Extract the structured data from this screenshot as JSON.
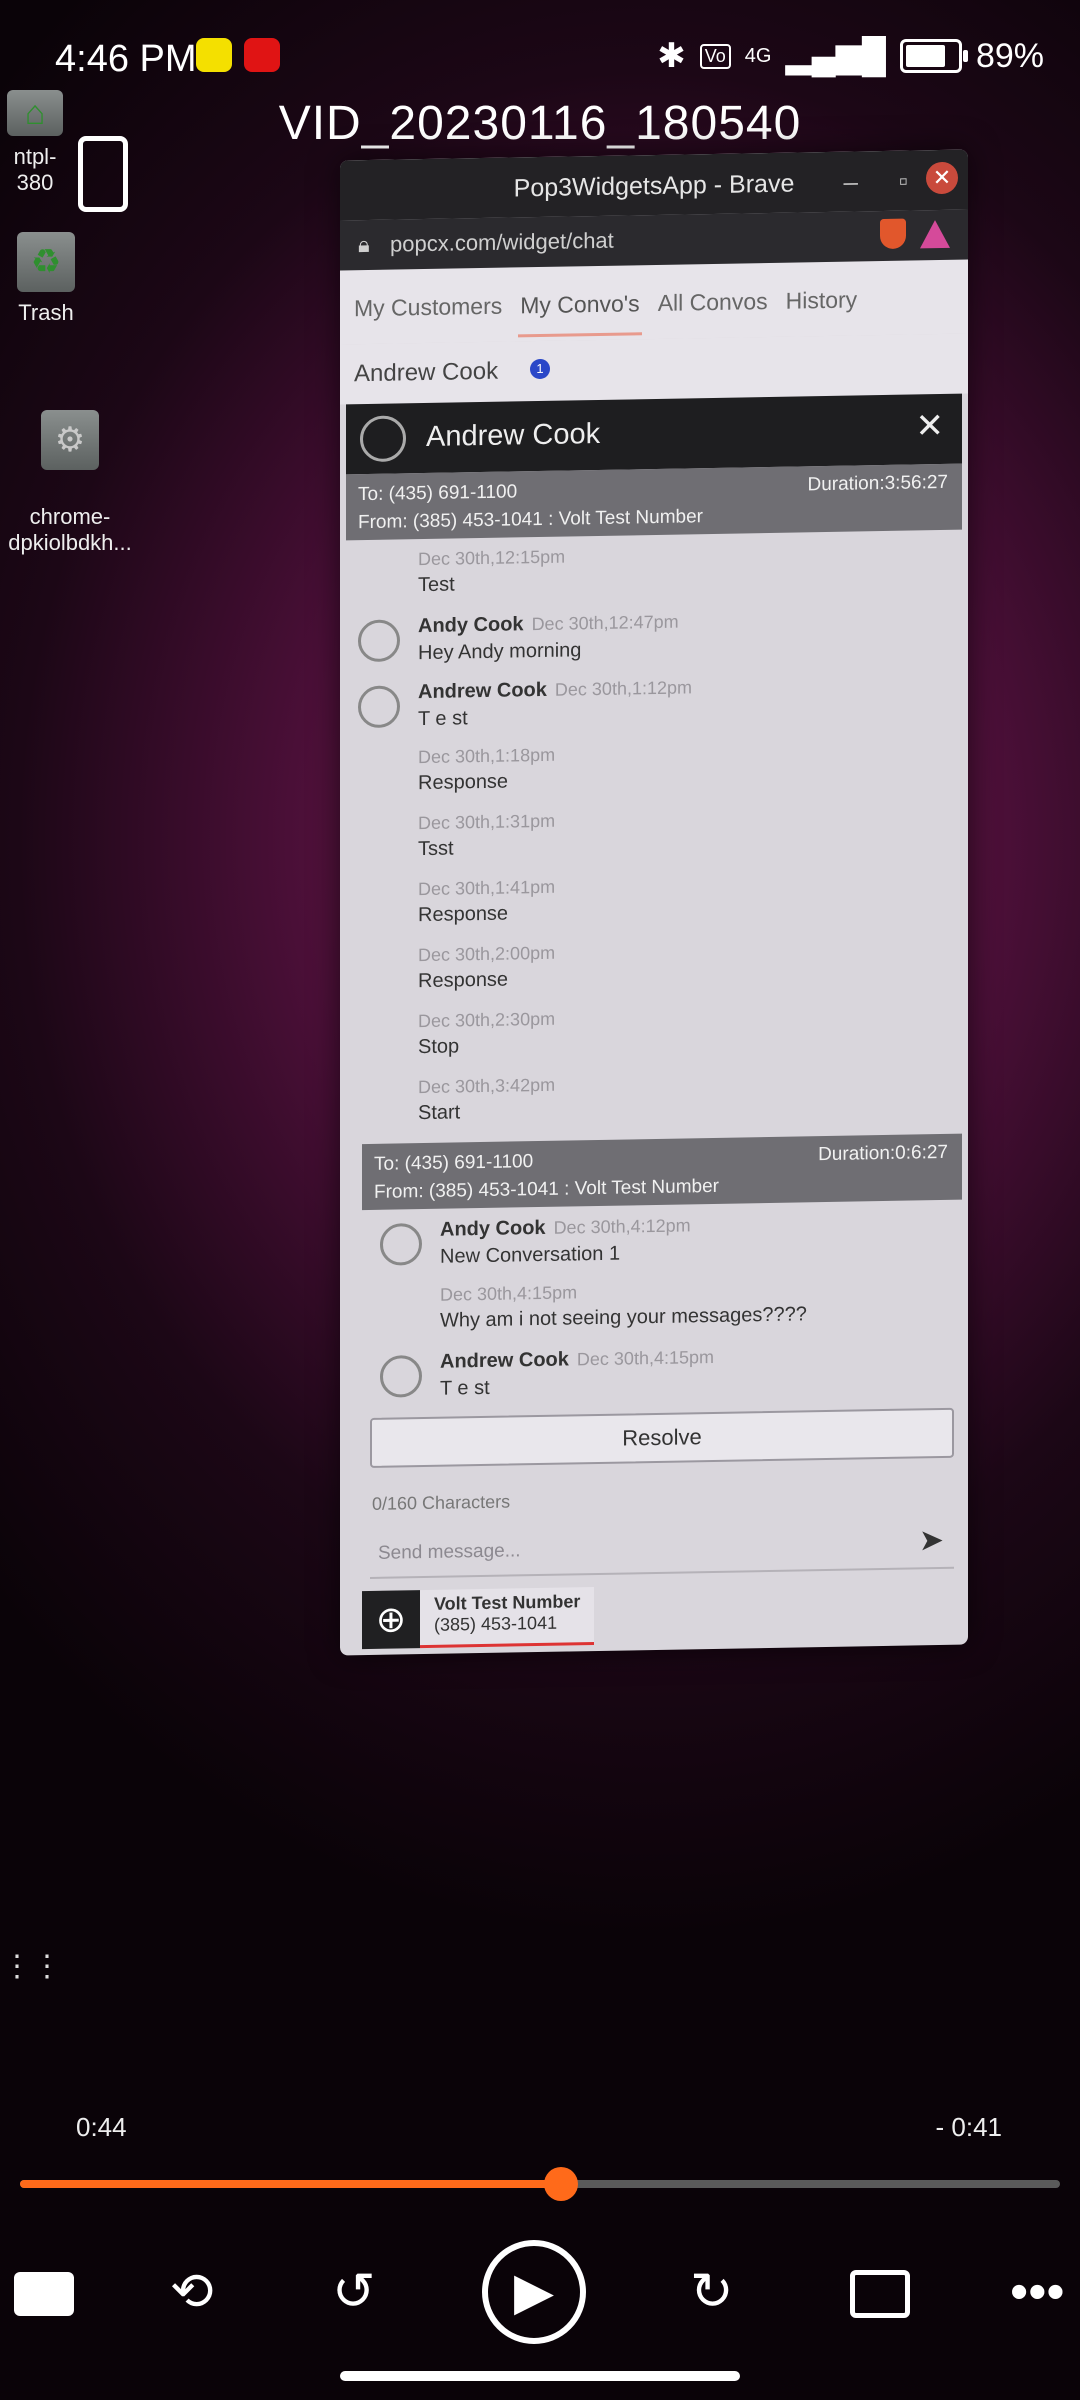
{
  "status": {
    "time": "4:46 PM",
    "network": "4G",
    "battery": "89%",
    "battery_level": 0.89
  },
  "video": {
    "title": "VID_20230116_180540",
    "elapsed": "0:44",
    "remaining": "- 0:41",
    "progress": 0.52
  },
  "desktop": {
    "items": [
      {
        "label": "ntpl-380",
        "icon": "home-folder-icon"
      },
      {
        "label": "Trash",
        "icon": "trash-icon"
      },
      {
        "label": "chrome-\ndpkiolbdkh...",
        "icon": "chrome-app-icon"
      }
    ]
  },
  "browser": {
    "window_title": "Pop3WidgetsApp - Brave",
    "url": "popcx.com/widget/chat"
  },
  "widget": {
    "tabs": [
      "My Customers",
      "My Convo's",
      "All Convos",
      "History"
    ],
    "active_tab": 1,
    "selected_convo": "Andrew Cook",
    "selected_badge": "1",
    "chat_header": "Andrew Cook",
    "conversations": [
      {
        "to": "To: (435) 691-1100",
        "from": "From: (385) 453-1041 : Volt Test Number",
        "duration": "Duration:3:56:27",
        "messages": [
          {
            "sender": "",
            "time": "Dec 30th,12:15pm",
            "text": "Test",
            "avatar": false
          },
          {
            "sender": "Andy Cook",
            "time": "Dec 30th,12:47pm",
            "text": "Hey Andy morning",
            "avatar": true
          },
          {
            "sender": "Andrew Cook",
            "time": "Dec 30th,1:12pm",
            "text": "T e st",
            "avatar": true
          },
          {
            "sender": "",
            "time": "Dec 30th,1:18pm",
            "text": "Response",
            "avatar": false
          },
          {
            "sender": "",
            "time": "Dec 30th,1:31pm",
            "text": "Tsst",
            "avatar": false
          },
          {
            "sender": "",
            "time": "Dec 30th,1:41pm",
            "text": "Response",
            "avatar": false
          },
          {
            "sender": "",
            "time": "Dec 30th,2:00pm",
            "text": "Response",
            "avatar": false
          },
          {
            "sender": "",
            "time": "Dec 30th,2:30pm",
            "text": "Stop",
            "avatar": false
          },
          {
            "sender": "",
            "time": "Dec 30th,3:42pm",
            "text": "Start",
            "avatar": false
          }
        ]
      },
      {
        "to": "To: (435) 691-1100",
        "from": "From: (385) 453-1041 : Volt Test Number",
        "duration": "Duration:0:6:27",
        "messages": [
          {
            "sender": "Andy Cook",
            "time": "Dec 30th,4:12pm",
            "text": "New Conversation 1",
            "avatar": true
          },
          {
            "sender": "",
            "time": "Dec 30th,4:15pm",
            "text": "Why am i not seeing your messages????",
            "avatar": false
          },
          {
            "sender": "Andrew Cook",
            "time": "Dec 30th,4:15pm",
            "text": "T e st",
            "avatar": true
          }
        ]
      }
    ],
    "resolve_label": "Resolve",
    "char_count": "0/160 Characters",
    "compose_placeholder": "Send message...",
    "number_name": "Volt Test Number",
    "number_value": "(385) 453-1041"
  },
  "icons": {
    "rotate": "screen-rotate-icon",
    "subtitles": "subtitles-icon",
    "loop": "repeat-icon",
    "rewind": "rewind-4-icon",
    "play": "play-icon",
    "forward": "forward-4-icon",
    "aspect": "aspect-ratio-icon",
    "more": "more-icon"
  },
  "colors": {
    "accent": "#ff6a1a",
    "badge": "#2a47c8"
  }
}
